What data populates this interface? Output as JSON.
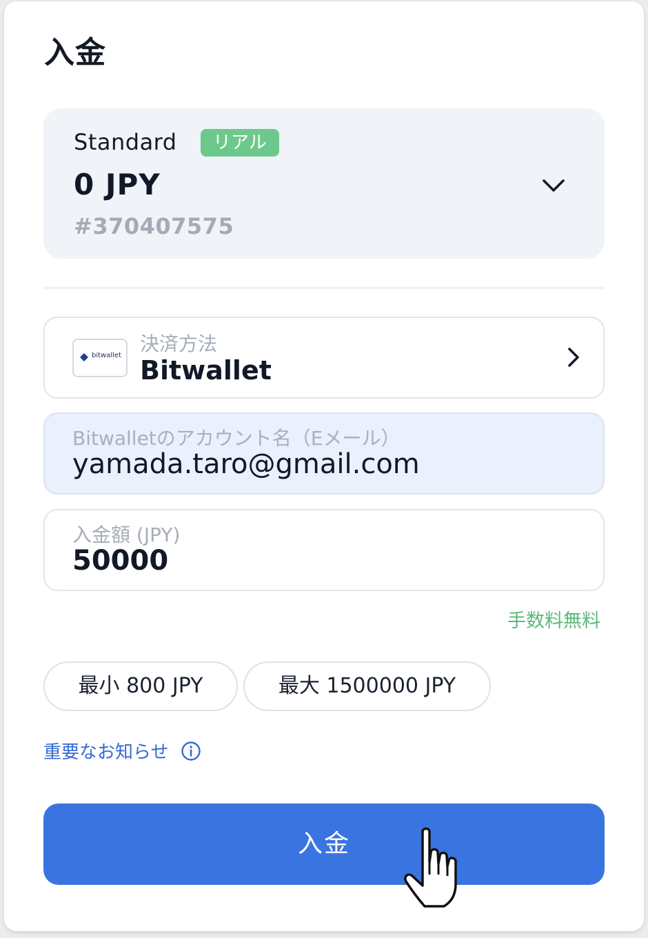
{
  "title": "入金",
  "account": {
    "name": "Standard",
    "badge": "リアル",
    "balance": "0 JPY",
    "id": "#370407575"
  },
  "payment_method": {
    "label": "決済方法",
    "value": "Bitwallet",
    "logo_text": "bitwallet"
  },
  "email_field": {
    "label": "Bitwalletのアカウント名（Eメール）",
    "value": "yamada.taro@gmail.com"
  },
  "amount_field": {
    "label": "入金額 (JPY)",
    "value": "50000"
  },
  "fee_note": "手数料無料",
  "limits": {
    "min": "最小 800 JPY",
    "max": "最大 1500000 JPY"
  },
  "notice_link": "重要なお知らせ",
  "submit_label": "入金",
  "colors": {
    "accent": "#3a74e0",
    "badge": "#6cc98b",
    "fee": "#5cb87a",
    "link": "#3569d4"
  },
  "icons": [
    "chevron-down-icon",
    "chevron-right-icon",
    "bitwallet-logo",
    "info-icon",
    "hand-cursor-icon"
  ]
}
